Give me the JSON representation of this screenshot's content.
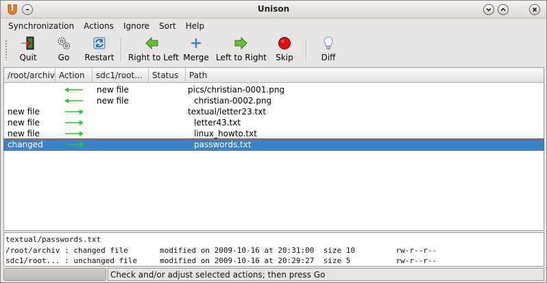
{
  "window": {
    "title": "Unison"
  },
  "menubar": {
    "items": [
      "Synchronization",
      "Actions",
      "Ignore",
      "Sort",
      "Help"
    ]
  },
  "toolbar": {
    "quit": "Quit",
    "go": "Go",
    "restart": "Restart",
    "right_to_left": "Right to Left",
    "merge": "Merge",
    "left_to_right": "Left to Right",
    "skip": "Skip",
    "diff": "Diff"
  },
  "table": {
    "headers": [
      "/root/archiv",
      "Action",
      "sdc1/root...",
      "Status",
      "Path"
    ],
    "rows": [
      {
        "left": "",
        "action": "left",
        "right": "new file",
        "status": "",
        "path": "pics/christian-0001.png",
        "indent": false
      },
      {
        "left": "",
        "action": "left",
        "right": "new file",
        "status": "",
        "path": "christian-0002.png",
        "indent": true
      },
      {
        "left": "new file",
        "action": "right",
        "right": "",
        "status": "",
        "path": "textual/letter23.txt",
        "indent": false
      },
      {
        "left": "new file",
        "action": "right",
        "right": "",
        "status": "",
        "path": "letter43.txt",
        "indent": true
      },
      {
        "left": "new file",
        "action": "right",
        "right": "",
        "status": "",
        "path": "linux_howto.txt",
        "indent": true
      },
      {
        "left": "changed",
        "action": "right",
        "right": "",
        "status": "",
        "path": "passwords.txt",
        "indent": true,
        "selected": true
      }
    ]
  },
  "details": {
    "line1": "textual/passwords.txt",
    "line2": "/root/archiv : changed file       modified on 2009-10-16 at 20:31:00  size 10         rw-r--r--",
    "line3": "sdc1/root... : unchanged file     modified on 2009-10-16 at 20:29:27  size 5          rw-r--r--"
  },
  "status": {
    "text": "Check and/or adjust selected actions; then press Go"
  },
  "colors": {
    "selection": "#3c84c9",
    "arrow": "#22cc22"
  }
}
